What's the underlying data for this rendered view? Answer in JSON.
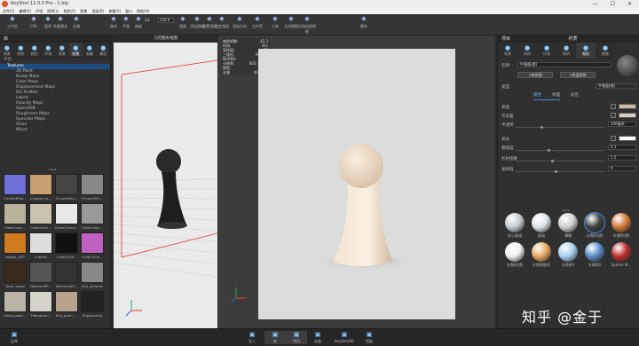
{
  "titlebar": {
    "title": "KeyShot 11.0.0 Pro - 1.bip",
    "min": "—",
    "max": "☐",
    "close": "✕"
  },
  "menu": [
    "文件(F)",
    "编辑(E)",
    "环境",
    "照明(L)",
    "相机(C)",
    "图像",
    "渲染(R)",
    "查看(V)",
    "窗口",
    "帮助(H)"
  ],
  "toolbar": {
    "buttons": [
      {
        "label": "工作区",
        "icon": "workspace-icon"
      },
      {
        "label": "CPU",
        "icon": "cpu-icon"
      },
      {
        "label": "暂停",
        "icon": "pause-icon"
      },
      {
        "label": "性能模式",
        "icon": "performance-icon"
      },
      {
        "label": "去噪",
        "icon": "denoise-icon"
      },
      {
        "label": "移动",
        "icon": "move-icon"
      },
      {
        "label": "平移",
        "icon": "pan-icon"
      },
      {
        "label": "缩放",
        "icon": "zoom-icon"
      },
      {
        "label": "视角",
        "icon": "view-angle-icon"
      },
      {
        "label": "添加相机",
        "icon": "add-camera-icon"
      },
      {
        "label": "重置相机",
        "icon": "reset-camera-icon"
      },
      {
        "label": "锁定相机",
        "icon": "lock-camera-icon"
      },
      {
        "label": "添加几何",
        "icon": "add-geometry-icon"
      },
      {
        "label": "工作室",
        "icon": "studio-icon"
      },
      {
        "label": "工具",
        "icon": "tools-icon"
      },
      {
        "label": "几何视图",
        "icon": "geometry-view-icon"
      },
      {
        "label": "光线追踪视图",
        "icon": "raytrace-view-icon"
      },
      {
        "label": "脚本",
        "icon": "script-icon"
      }
    ],
    "fps_label": "24",
    "zoom_value": "136.0"
  },
  "left_panel": {
    "title": "库",
    "tabs": [
      {
        "label": "场景",
        "icon": "scene-icon"
      },
      {
        "label": "材质",
        "icon": "material-icon"
      },
      {
        "label": "颜色",
        "icon": "color-icon"
      },
      {
        "label": "环境",
        "icon": "environment-icon"
      },
      {
        "label": "背景",
        "icon": "background-icon"
      },
      {
        "label": "纹理",
        "icon": "texture-icon"
      },
      {
        "label": "收藏",
        "icon": "favorites-icon"
      },
      {
        "label": "模型",
        "icon": "models-icon"
      }
    ],
    "search_placeholder": "不新",
    "tree": [
      {
        "label": "Textures",
        "level": 0,
        "selected": true
      },
      {
        "label": "3D Paint",
        "level": 1
      },
      {
        "label": "Bump Maps",
        "level": 1
      },
      {
        "label": "Color Maps",
        "level": 1
      },
      {
        "label": "Displacement Maps",
        "level": 1
      },
      {
        "label": "IES Profiles",
        "level": 1
      },
      {
        "label": "Labels",
        "level": 1
      },
      {
        "label": "Opacity Maps",
        "level": 1
      },
      {
        "label": "OpenVDB",
        "level": 1
      },
      {
        "label": "Roughness Maps",
        "level": 1
      },
      {
        "label": "Specular Maps",
        "level": 1
      },
      {
        "label": "Vizoo",
        "level": 1
      },
      {
        "label": "Wood",
        "level": 1
      }
    ],
    "thumbs": [
      {
        "label": "CementFlat...",
        "color": "#6f6fd8"
      },
      {
        "label": "chipped m...",
        "color": "#c8a070"
      },
      {
        "label": "CircularBru...",
        "color": "#444"
      },
      {
        "label": "CircularBru...",
        "color": "#888"
      },
      {
        "label": "CleanConc...",
        "color": "#b8b29a"
      },
      {
        "label": "CleanConc...",
        "color": "#c9c3ad"
      },
      {
        "label": "CleanConcrt...",
        "color": "#e8e8e8"
      },
      {
        "label": "CleanConc...",
        "color": "#999"
      },
      {
        "label": "copper_NTC",
        "color": "#d07a20"
      },
      {
        "label": "crackle",
        "color": "#ddd"
      },
      {
        "label": "CropCircle...",
        "color": "#111"
      },
      {
        "label": "CropCircle...",
        "color": "#c060c0"
      },
      {
        "label": "Dark_wood",
        "color": "#3a2a1a"
      },
      {
        "label": "DiamondPl...",
        "color": "#555"
      },
      {
        "label": "DiamondPl...",
        "color": "#333"
      },
      {
        "label": "dull_ceramic",
        "color": "#888"
      },
      {
        "label": "dusty-patin...",
        "color": "#b9b4a5"
      },
      {
        "label": "Fiberglass...",
        "color": "#d4d4cc"
      },
      {
        "label": "fine_grain_...",
        "color": "#b8a48c"
      },
      {
        "label": "fingerprints",
        "color": "#222"
      }
    ]
  },
  "geo_view": {
    "title": "几何图形视图"
  },
  "stats": [
    {
      "k": "每秒帧数:",
      "v": "42.3"
    },
    {
      "k": "时间:",
      "v": "41s"
    },
    {
      "k": "采样值:",
      "v": "73"
    },
    {
      "k": "三角形:",
      "v": "94,592"
    },
    {
      "k": "NURBS:",
      "v": "0"
    },
    {
      "k": "分辨率:",
      "v": "603 × 805"
    },
    {
      "k": "焦距:",
      "v": "135.0"
    },
    {
      "k": "去噪:",
      "v": "关闭 (关)"
    }
  ],
  "right_panel": {
    "title1": "项目",
    "title2": "材质",
    "tabs": [
      {
        "label": "场景",
        "icon": "scene-icon"
      },
      {
        "label": "材质",
        "icon": "material-icon"
      },
      {
        "label": "环境",
        "icon": "environment-icon"
      },
      {
        "label": "照明",
        "icon": "lighting-icon"
      },
      {
        "label": "相机",
        "icon": "camera-icon"
      },
      {
        "label": "图像",
        "icon": "image-icon"
      }
    ],
    "name_label": "名称:",
    "name_value": "牛顿面(透)",
    "btn_graph": "+材质图",
    "btn_multi": "+多层材质",
    "type_label": "类型:",
    "type_value": "牛顿面(透)",
    "subtabs": [
      "属性",
      "纹理",
      "标签"
    ],
    "props": [
      {
        "label": "表面",
        "kind": "color",
        "color": "#c9b9a6"
      },
      {
        "label": "次表面",
        "kind": "color",
        "color": "#d9cfc3"
      },
      {
        "label": "半透明",
        "kind": "value",
        "value": "200毫米"
      },
      {
        "label": "高光",
        "kind": "color",
        "color": "#ffffff"
      },
      {
        "label": "粗糙度",
        "kind": "value",
        "value": "0.1"
      },
      {
        "label": "折射指数",
        "kind": "value",
        "value": "1.5"
      },
      {
        "label": "采样值",
        "kind": "value",
        "value": "9"
      }
    ],
    "materials": [
      {
        "label": "实心玻璃",
        "color": "#c8ccd0"
      },
      {
        "label": "玻璃",
        "color": "#e0e4e8"
      },
      {
        "label": "薄膜",
        "color": "#d0d0d0"
      },
      {
        "label": "半透明(透)",
        "color": "#404040"
      },
      {
        "label": "半透明(透)",
        "color": "#d07a3a"
      },
      {
        "label": "半透明(透)",
        "color": "#f0f0f0"
      },
      {
        "label": "半透明胶质",
        "color": "#e8a860"
      },
      {
        "label": "半透明3",
        "color": "#a8d0f0"
      },
      {
        "label": "半透明2",
        "color": "#5a8ac8"
      },
      {
        "label": "Sphere M...",
        "color": "#c03030"
      }
    ]
  },
  "statusbar": [
    {
      "label": "云库",
      "icon": "cloud-icon"
    },
    {
      "label": "导入",
      "icon": "import-icon"
    },
    {
      "label": "库",
      "icon": "library-icon",
      "active": true
    },
    {
      "label": "项目",
      "icon": "project-icon",
      "active": true
    },
    {
      "label": "动画",
      "icon": "animation-icon"
    },
    {
      "label": "KeyShotXR",
      "icon": "keyshotxr-icon"
    },
    {
      "label": "渲染",
      "icon": "render-icon"
    }
  ],
  "watermark": "知乎 @金于"
}
